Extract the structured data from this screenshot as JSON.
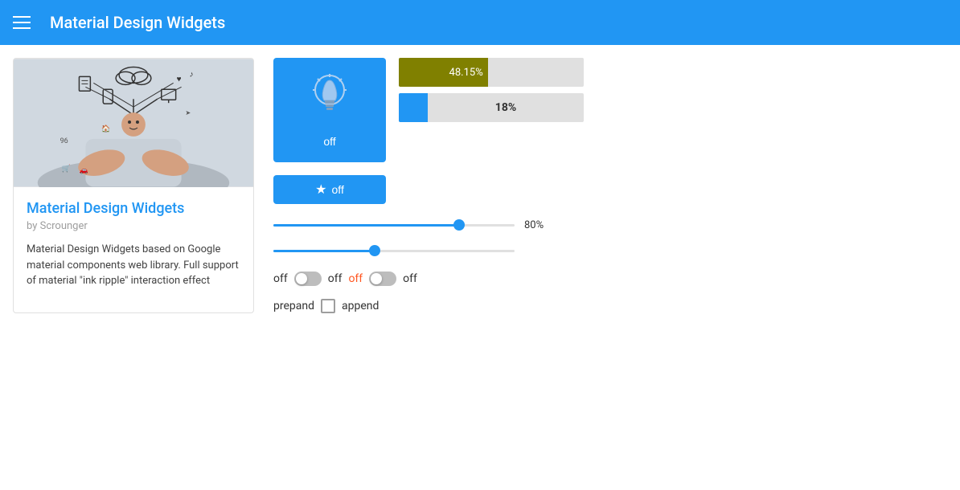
{
  "header": {
    "title": "Material Design Widgets"
  },
  "card": {
    "title": "Material Design Widgets",
    "author": "by Scrounger",
    "description": "Material Design Widgets based on Google material components web library. Full support of material \"ink ripple\" interaction effect"
  },
  "widgets": {
    "bulb_button_label": "off",
    "star_button_label": "off",
    "progress_bar_1_value": "48.15%",
    "progress_bar_2_value": "18%",
    "slider_1_label": "80%",
    "toggle_1_label": "off",
    "toggle_2_label": "off",
    "toggle_3_label": "off",
    "toggle_4_label": "off",
    "checkbox_prepend_label": "prepand",
    "checkbox_append_label": "append"
  }
}
